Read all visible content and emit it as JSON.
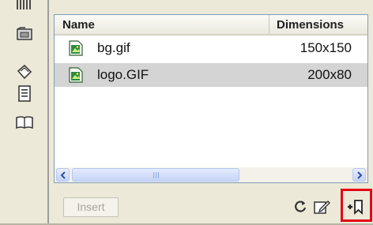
{
  "file_list": {
    "columns": {
      "name": "Name",
      "dimensions": "Dimensions"
    },
    "rows": [
      {
        "name": "bg.gif",
        "dimensions": "150x150",
        "icon": "image-file-icon",
        "selected": false
      },
      {
        "name": "logo.GIF",
        "dimensions": "200x80",
        "icon": "image-file-icon",
        "selected": true
      }
    ],
    "scrollbar": {
      "grip": "III"
    }
  },
  "bottom_bar": {
    "insert_label": "Insert",
    "icons": [
      "refresh-icon",
      "edit-icon",
      "add-to-favorites-icon"
    ]
  },
  "left_strip": {
    "icons": [
      "assets-icon",
      "folder-icon",
      "tag-icon",
      "document-icon",
      "library-icon"
    ]
  },
  "colors": {
    "highlight": "#e30613",
    "selection": "#d4d4d4",
    "panel_bg": "#ece9d8"
  }
}
